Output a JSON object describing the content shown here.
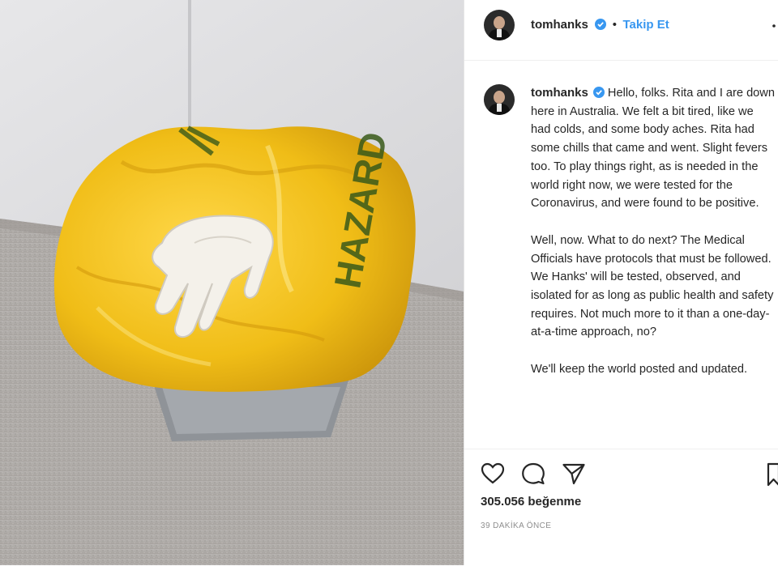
{
  "post": {
    "username": "tomhanks",
    "follow_label": "Takip Et",
    "separator": "•",
    "caption_paragraphs": [
      "Hello, folks. Rita and I are down here in Australia. We felt a bit tired, like we had colds, and some body aches. Rita had some chills that came and went. Slight fevers too. To play things right, as is needed in the world right now, we were tested for the Coronavirus, and were found to be positive.",
      "Well, now. What to do next? The Medical Officials have protocols that must be followed. We Hanks' will be tested, observed, and isolated for as long as public health and safety requires. Not much more to it than a one-day-at-a-time approach, no?",
      "We'll keep the world posted and updated."
    ],
    "likes": "305.056 beğenme",
    "time": "39 DAKİKA ÖNCE"
  },
  "photo": {
    "subject": "yellow biohazard bag in grey bin with white latex glove",
    "bag_print": "HAZARD"
  },
  "icons": {
    "verified": "verified-badge-icon",
    "more": "more-options-icon",
    "like": "heart-icon",
    "comment": "comment-icon",
    "share": "share-icon",
    "save": "bookmark-icon"
  },
  "colors": {
    "link": "#3897f0",
    "text": "#262626",
    "muted": "#8e8e8e",
    "bag": "#f2c21a"
  }
}
